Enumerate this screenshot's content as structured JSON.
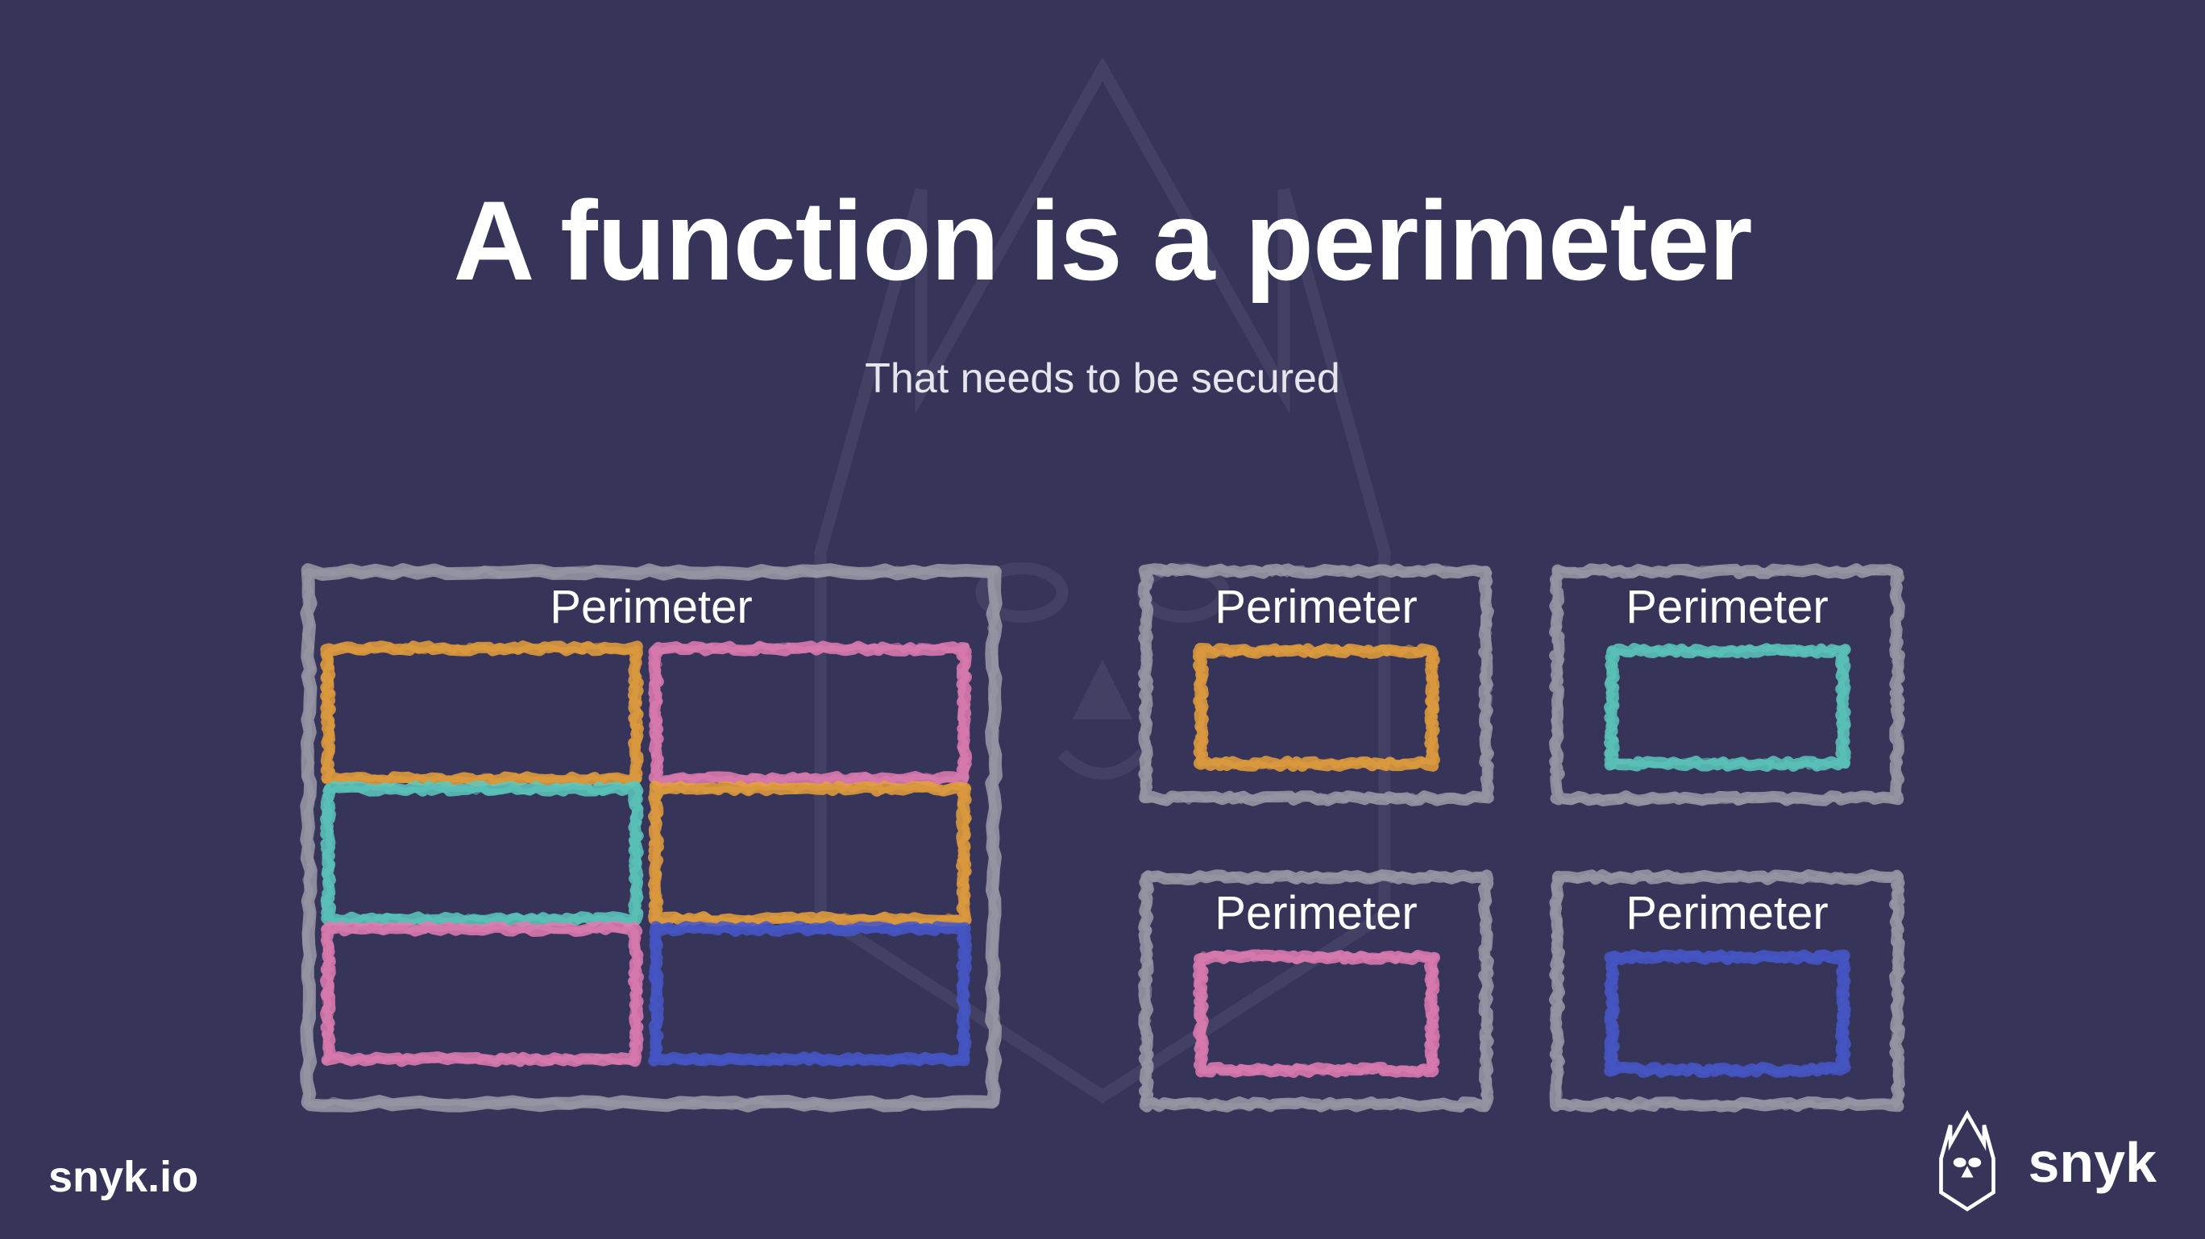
{
  "title": "A function is a perimeter",
  "subtitle": "That needs to be secured",
  "colors": {
    "grey": "#9b9ba8",
    "orange": "#e6a03c",
    "pink": "#e07db3",
    "teal": "#5cc9bd",
    "blue": "#4557c9"
  },
  "leftBox": {
    "label": "Perimeter",
    "cells": [
      {
        "color": "orange"
      },
      {
        "color": "pink"
      },
      {
        "color": "teal"
      },
      {
        "color": "orange"
      },
      {
        "color": "pink"
      },
      {
        "color": "blue"
      }
    ]
  },
  "rightBoxes": [
    {
      "label": "Perimeter",
      "color": "orange"
    },
    {
      "label": "Perimeter",
      "color": "teal"
    },
    {
      "label": "Perimeter",
      "color": "pink"
    },
    {
      "label": "Perimeter",
      "color": "blue"
    }
  ],
  "footer": {
    "leftText": "snyk.io",
    "rightText": "snyk"
  }
}
